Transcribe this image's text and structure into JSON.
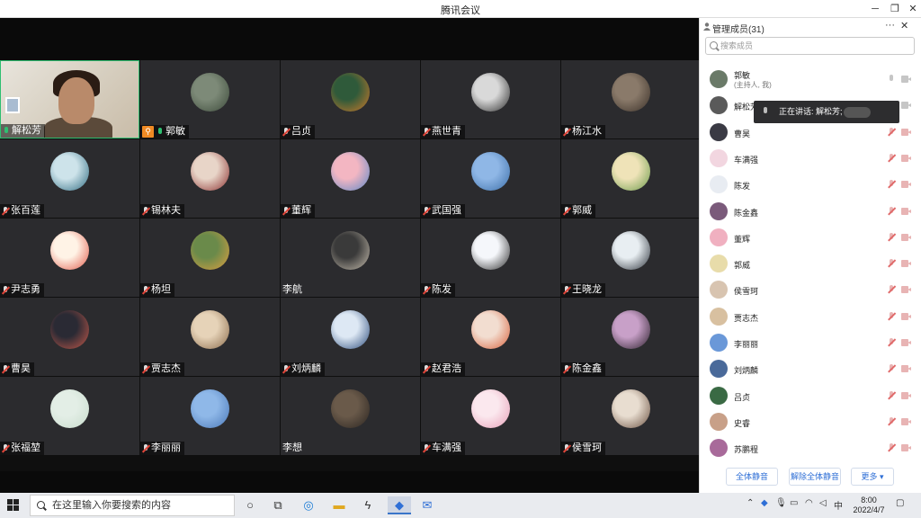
{
  "window": {
    "title": "腾讯会议"
  },
  "grid": [
    [
      {
        "name": "解松芳",
        "mic": "on",
        "camera": true,
        "active": true,
        "colors": [
          "#e5e0d6",
          "#b98a6a"
        ]
      },
      {
        "name": "郭敏",
        "mic": "on",
        "host": true,
        "colors": [
          "#7d8a78",
          "#3c4a3a"
        ]
      },
      {
        "name": "吕贞",
        "mic": "muted",
        "colors": [
          "#2f5a3a",
          "#d07a2a"
        ]
      },
      {
        "name": "燕世青",
        "mic": "muted",
        "colors": [
          "#d9d9d9",
          "#2a2a2a"
        ]
      },
      {
        "name": "杨江水",
        "mic": "muted",
        "colors": [
          "#8a7a6a",
          "#3a3028"
        ]
      }
    ],
    [
      {
        "name": "张百莲",
        "mic": "muted",
        "colors": [
          "#cde3ea",
          "#2e6a80"
        ]
      },
      {
        "name": "锡林夫",
        "mic": "muted",
        "colors": [
          "#e8d5c8",
          "#8a2e2e"
        ]
      },
      {
        "name": "董辉",
        "mic": "muted",
        "colors": [
          "#f3b6c2",
          "#5a88c8"
        ]
      },
      {
        "name": "武国强",
        "mic": "muted",
        "colors": [
          "#8fb7e6",
          "#3b6ea8"
        ]
      },
      {
        "name": "郭威",
        "mic": "muted",
        "colors": [
          "#efe3b8",
          "#6a9a4a"
        ]
      }
    ],
    [
      {
        "name": "尹志勇",
        "mic": "muted",
        "colors": [
          "#fff3e6",
          "#e25a4a"
        ]
      },
      {
        "name": "杨坦",
        "mic": "muted",
        "colors": [
          "#6a8a4a",
          "#e0a040"
        ]
      },
      {
        "name": "李航",
        "mic": "none",
        "colors": [
          "#3a3a3a",
          "#c9c0b0"
        ]
      },
      {
        "name": "陈发",
        "mic": "muted",
        "colors": [
          "#f5f7fb",
          "#2a2a2a"
        ]
      },
      {
        "name": "王晓龙",
        "mic": "muted",
        "colors": [
          "#e8eef2",
          "#2a3038"
        ]
      }
    ],
    [
      {
        "name": "曹昊",
        "mic": "muted",
        "colors": [
          "#2a2a34",
          "#c85a4a"
        ]
      },
      {
        "name": "贾志杰",
        "mic": "muted",
        "colors": [
          "#e6d3b8",
          "#8a6a4a"
        ]
      },
      {
        "name": "刘炳麟",
        "mic": "muted",
        "colors": [
          "#dde8f4",
          "#2a4a7a"
        ]
      },
      {
        "name": "赵君浩",
        "mic": "muted",
        "colors": [
          "#f2ddd0",
          "#d8603a"
        ]
      },
      {
        "name": "陈金鑫",
        "mic": "muted",
        "colors": [
          "#c8a0c8",
          "#2a1e2a"
        ]
      }
    ],
    [
      {
        "name": "张福堃",
        "mic": "muted",
        "colors": [
          "#e3eee6",
          "#c8dccc"
        ]
      },
      {
        "name": "李丽丽",
        "mic": "muted",
        "colors": [
          "#8fb8e8",
          "#4a78b8"
        ]
      },
      {
        "name": "李想",
        "mic": "none",
        "colors": [
          "#6a5a4a",
          "#2a2420"
        ]
      },
      {
        "name": "车满强",
        "mic": "muted",
        "colors": [
          "#fbe8ee",
          "#e8a0b8"
        ]
      },
      {
        "name": "侯雪珂",
        "mic": "muted",
        "colors": [
          "#e8ddd0",
          "#6a5040"
        ]
      }
    ]
  ],
  "panel": {
    "title": "管理成员(31)",
    "more": "···",
    "close": "✕",
    "search_placeholder": "搜索成员",
    "members": [
      {
        "name": "郭敏",
        "sub": "(主持人, 我)",
        "mic": "on",
        "cam": "on",
        "color": "#6a7a68"
      },
      {
        "name": "解松芳",
        "mic": "on",
        "cam": "on",
        "color": "#5a5a5a"
      },
      {
        "name": "曹昊",
        "mic": "muted",
        "cam": "muted",
        "color": "#3a3a44"
      },
      {
        "name": "车满强",
        "mic": "muted",
        "cam": "muted",
        "color": "#f2d6e0"
      },
      {
        "name": "陈发",
        "mic": "muted",
        "cam": "muted",
        "color": "#e8ecf2"
      },
      {
        "name": "陈金鑫",
        "mic": "muted",
        "cam": "muted",
        "color": "#7a5a7a"
      },
      {
        "name": "董辉",
        "mic": "muted",
        "cam": "muted",
        "color": "#f0b0c0"
      },
      {
        "name": "郭威",
        "mic": "muted",
        "cam": "muted",
        "color": "#e8dcaa"
      },
      {
        "name": "侯雪珂",
        "mic": "muted",
        "cam": "muted",
        "color": "#d8c4b0"
      },
      {
        "name": "贾志杰",
        "mic": "muted",
        "cam": "muted",
        "color": "#d8c0a0"
      },
      {
        "name": "李丽丽",
        "mic": "muted",
        "cam": "muted",
        "color": "#6a98d8"
      },
      {
        "name": "刘炳麟",
        "mic": "muted",
        "cam": "muted",
        "color": "#4a6a9a"
      },
      {
        "name": "吕贞",
        "mic": "muted",
        "cam": "muted",
        "color": "#3a6a44"
      },
      {
        "name": "史睿",
        "mic": "muted",
        "cam": "muted",
        "color": "#c8a088"
      },
      {
        "name": "苏鹏程",
        "mic": "muted",
        "cam": "muted",
        "color": "#a86a9a"
      }
    ],
    "tooltip": "正在讲话: 解松芳;",
    "buttons": {
      "mute_all": "全体静音",
      "unmute_all": "解除全体静音",
      "more": "更多 ▾"
    }
  },
  "taskbar": {
    "search_placeholder": "在这里输入你要搜索的内容",
    "time": "8:00",
    "date": "2022/4/7",
    "ime": "中"
  }
}
